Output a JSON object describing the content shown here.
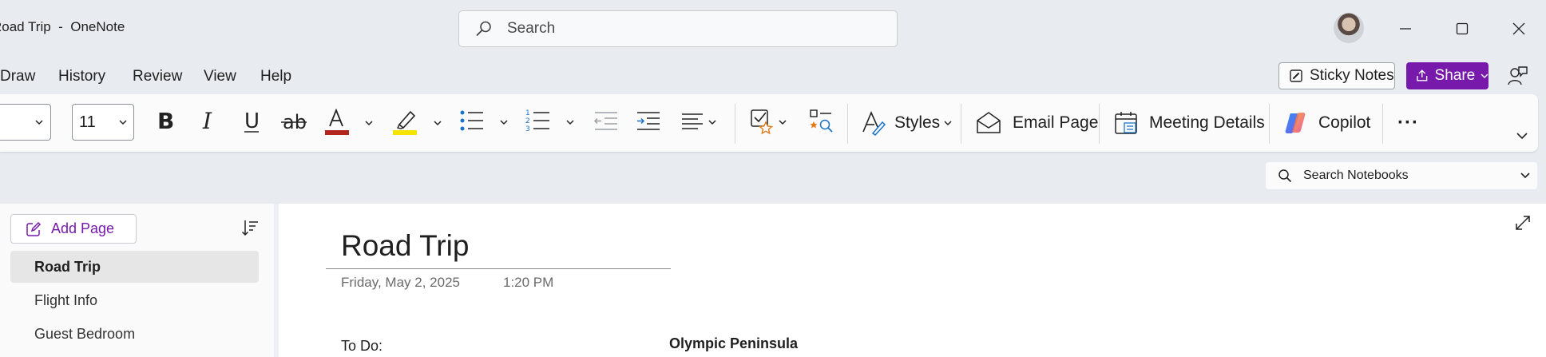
{
  "window": {
    "title": "Road Trip  -  OneNote",
    "search_placeholder": "Search"
  },
  "menu": [
    "Draw",
    "History",
    "Review",
    "View",
    "Help"
  ],
  "header_buttons": {
    "sticky_notes": "Sticky Notes",
    "share": "Share"
  },
  "ribbon": {
    "font_size": "11",
    "styles": "Styles",
    "email_page": "Email Page",
    "meeting_details": "Meeting Details",
    "copilot": "Copilot",
    "more": "···",
    "font_color": "#b3261e",
    "highlight_color": "#f5e400",
    "accent_color": "#7719aa"
  },
  "notebook_search": {
    "placeholder": "Search Notebooks"
  },
  "pages_panel": {
    "add_page": "Add Page",
    "pages": [
      {
        "label": "Road Trip",
        "selected": true
      },
      {
        "label": "Flight Info",
        "selected": false
      },
      {
        "label": "Guest Bedroom",
        "selected": false
      }
    ]
  },
  "page": {
    "title": "Road Trip",
    "date": "Friday, May 2, 2025",
    "time": "1:20 PM",
    "todo_label": "To Do:",
    "section_heading": "Olympic Peninsula"
  }
}
